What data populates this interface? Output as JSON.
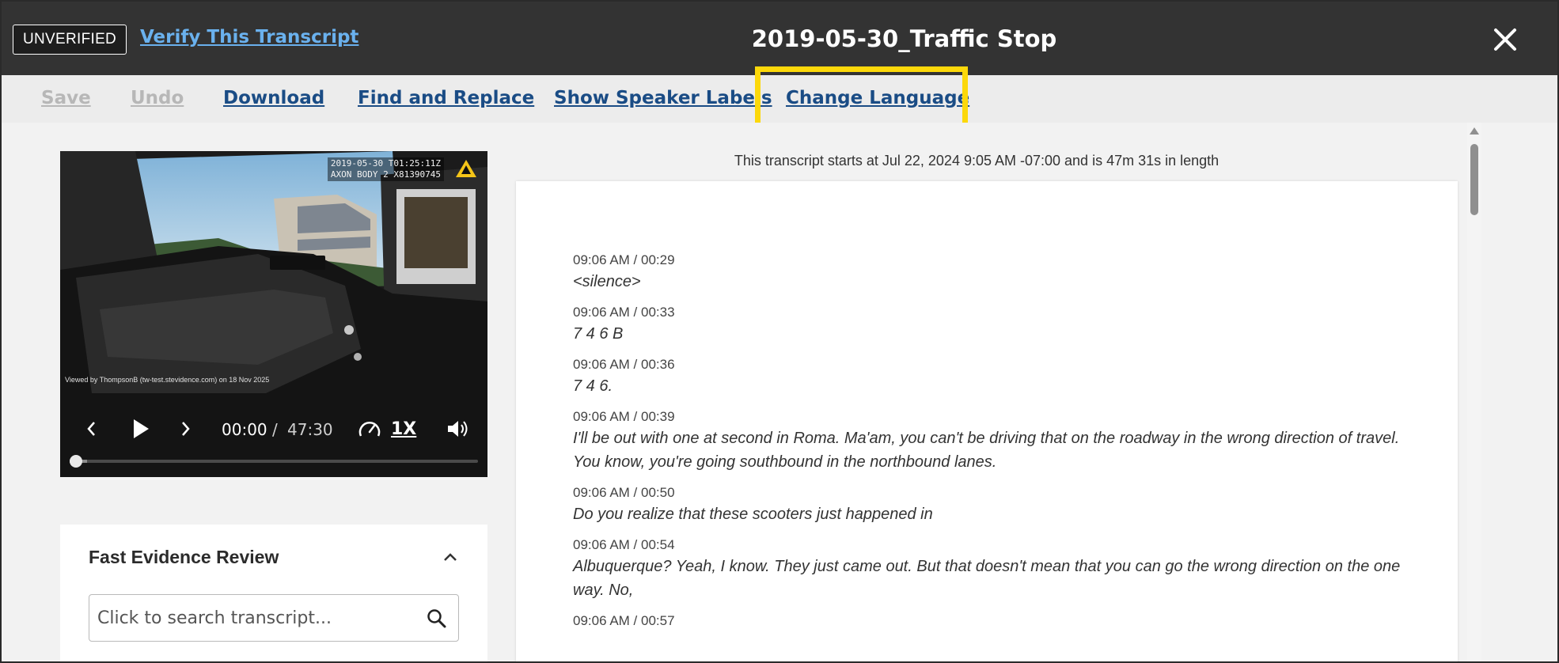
{
  "header": {
    "status_badge": "UNVERIFIED",
    "verify_link": "Verify This Transcript",
    "title": "2019-05-30_Traffic Stop",
    "close_icon": "close-icon"
  },
  "toolbar": {
    "save": "Save",
    "undo": "Undo",
    "download": "Download",
    "find_replace": "Find and Replace",
    "speaker_labels": "Show Speaker Labels",
    "change_language": "Change Language",
    "highlight_color": "#fcd80a",
    "link_color": "#1a4c85"
  },
  "video": {
    "overlay_line1": "2019-05-30 T01:25:11Z",
    "overlay_line2": "AXON BODY 2 X81390745",
    "watermark": "Viewed by ThompsonB (tw-test.stevidence.com) on 18 Nov 2025",
    "current_time": "00:00",
    "separator": "/",
    "total_time": "47:30",
    "speed": "1X",
    "progress": 0
  },
  "review": {
    "title": "Fast Evidence Review",
    "search_placeholder": "Click to search transcript..."
  },
  "transcript": {
    "summary": "This transcript starts at Jul 22, 2024 9:05 AM -07:00 and is 47m 31s in length",
    "segments": [
      {
        "time": "09:06 AM / 00:29",
        "text": "<silence>"
      },
      {
        "time": "09:06 AM / 00:33",
        "text": "7 4 6 B"
      },
      {
        "time": "09:06 AM / 00:36",
        "text": "7 4 6."
      },
      {
        "time": "09:06 AM / 00:39",
        "text": "I'll be out with one at second in Roma. Ma'am, you can't be driving that on the roadway in the wrong direction of travel. You know, you're going southbound in the northbound lanes."
      },
      {
        "time": "09:06 AM / 00:50",
        "text": "Do you realize that these scooters just happened in"
      },
      {
        "time": "09:06 AM / 00:54",
        "text": "Albuquerque? Yeah, I know. They just came out. But that doesn't mean that you can go the wrong direction on the one way. No,"
      },
      {
        "time": "09:06 AM / 00:57",
        "text": ""
      }
    ]
  }
}
